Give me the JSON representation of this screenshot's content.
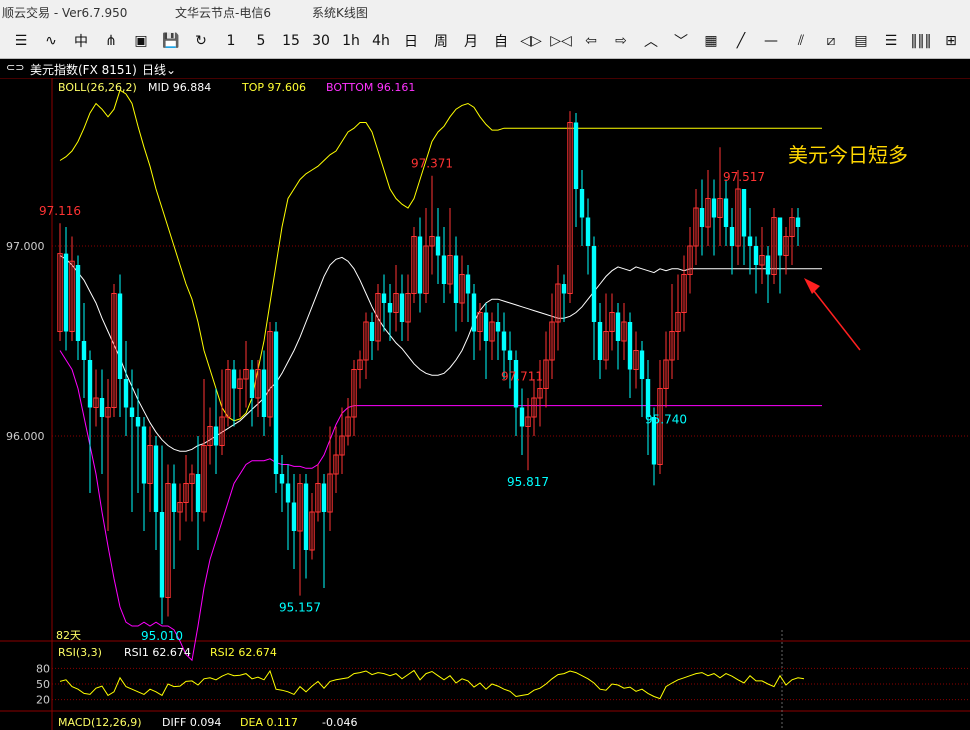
{
  "window": {
    "app_title": "顺云交易  -  Ver6.7.950",
    "node": "文华云节点-电信6",
    "menu": "系统K线图"
  },
  "toolbar": {
    "items": [
      "☰",
      "∿",
      "中",
      "⋔",
      "▣",
      "💾",
      "↻",
      "1",
      "5",
      "15",
      "30",
      "1h",
      "4h",
      "日",
      "周",
      "月",
      "自",
      "◁▷",
      "▷◁",
      "⇦",
      "⇨",
      "︿",
      "﹀",
      "▦",
      "╱",
      "—",
      "⫽",
      "⧄",
      "▤",
      "☰",
      "‖‖‖",
      "⊞"
    ]
  },
  "header": {
    "symbol": "美元指数(FX 8151)",
    "period": "日线"
  },
  "boll": {
    "label": "BOLL(26,26,2)",
    "mid_label": "MID",
    "mid": "96.884",
    "top_label": "TOP",
    "top": "97.606",
    "bottom_label": "BOTTOM",
    "bottom": "96.161"
  },
  "annotation_text": "美元今日短多",
  "bars_count_label": "82天",
  "rsi": {
    "label": "RSI(3,3)",
    "rsi1": "RSI1 62.674",
    "rsi2": "RSI2 62.674"
  },
  "macd": {
    "label": "MACD(12,26,9)",
    "diff": "DIFF 0.094",
    "dea": "DEA 0.117",
    "macd": "-0.046"
  },
  "colors": {
    "up": "#ff3333",
    "down": "#00ffff",
    "mid": "#ffffff",
    "upper": "#ffff00",
    "lower": "#ff00ff",
    "rsi": "#ffff00",
    "arrow": "#ff2020",
    "annotation": "#ffd700"
  },
  "chart_data": {
    "type": "candlestick",
    "y_ticks": [
      "97.000",
      "96.000"
    ],
    "ylim": [
      94.95,
      97.9
    ],
    "peak_labels": [
      {
        "value": "97.116",
        "bar": 0,
        "kind": "high"
      },
      {
        "value": "95.010",
        "bar": 17,
        "kind": "low"
      },
      {
        "value": "95.157",
        "bar": 40,
        "kind": "low"
      },
      {
        "value": "97.371",
        "bar": 62,
        "kind": "high"
      },
      {
        "value": "95.817",
        "bar": 78,
        "kind": "low"
      },
      {
        "value": "97.711",
        "bar": 77,
        "kind": "high"
      },
      {
        "value": "95.740",
        "bar": 101,
        "kind": "low"
      },
      {
        "value": "97.517",
        "bar": 114,
        "kind": "high"
      }
    ],
    "ohlc": [
      [
        96.55,
        96.96,
        96.5,
        97.12
      ],
      [
        96.96,
        96.55,
        96.45,
        97.1
      ],
      [
        96.55,
        96.92,
        96.5,
        97.05
      ],
      [
        96.9,
        96.5,
        96.4,
        96.95
      ],
      [
        96.5,
        96.4,
        96.2,
        96.7
      ],
      [
        96.4,
        96.15,
        95.7,
        96.45
      ],
      [
        96.15,
        96.2,
        96.05,
        96.35
      ],
      [
        96.2,
        96.1,
        95.8,
        96.35
      ],
      [
        96.1,
        96.15,
        95.5,
        96.3
      ],
      [
        96.15,
        96.75,
        96.1,
        96.8
      ],
      [
        96.75,
        96.3,
        96.1,
        96.85
      ],
      [
        96.3,
        96.15,
        96.0,
        96.5
      ],
      [
        96.15,
        96.1,
        95.6,
        96.35
      ],
      [
        96.1,
        96.05,
        95.7,
        96.25
      ],
      [
        96.05,
        95.75,
        95.5,
        96.1
      ],
      [
        95.75,
        95.95,
        95.6,
        96.05
      ],
      [
        95.95,
        95.6,
        95.4,
        96.0
      ],
      [
        95.6,
        95.15,
        95.01,
        95.95
      ],
      [
        95.15,
        95.75,
        95.05,
        95.85
      ],
      [
        95.75,
        95.6,
        95.3,
        95.85
      ],
      [
        95.6,
        95.65,
        95.45,
        95.75
      ],
      [
        95.65,
        95.75,
        95.55,
        95.9
      ],
      [
        95.75,
        95.8,
        95.55,
        95.85
      ],
      [
        95.8,
        95.6,
        95.4,
        96.0
      ],
      [
        95.6,
        95.95,
        95.55,
        96.3
      ],
      [
        95.95,
        96.05,
        95.85,
        96.15
      ],
      [
        96.05,
        95.95,
        95.8,
        96.25
      ],
      [
        95.95,
        96.1,
        95.9,
        96.35
      ],
      [
        96.1,
        96.35,
        96.05,
        96.4
      ],
      [
        96.35,
        96.25,
        96.05,
        96.4
      ],
      [
        96.25,
        96.3,
        96.1,
        96.35
      ],
      [
        96.3,
        96.35,
        96.15,
        96.5
      ],
      [
        96.35,
        96.2,
        96.05,
        96.4
      ],
      [
        96.2,
        96.35,
        96.1,
        96.4
      ],
      [
        96.35,
        96.1,
        96.0,
        96.45
      ],
      [
        96.1,
        96.55,
        96.05,
        96.6
      ],
      [
        96.55,
        95.8,
        95.7,
        96.6
      ],
      [
        95.8,
        95.75,
        95.6,
        95.9
      ],
      [
        95.75,
        95.65,
        95.4,
        95.85
      ],
      [
        95.65,
        95.5,
        95.3,
        95.8
      ],
      [
        95.5,
        95.75,
        95.16,
        95.8
      ],
      [
        95.75,
        95.4,
        95.25,
        95.8
      ],
      [
        95.4,
        95.6,
        95.35,
        95.7
      ],
      [
        95.6,
        95.75,
        95.55,
        95.85
      ],
      [
        95.75,
        95.6,
        95.2,
        95.8
      ],
      [
        95.6,
        95.8,
        95.5,
        96.05
      ],
      [
        95.8,
        95.9,
        95.7,
        96.05
      ],
      [
        95.9,
        96.0,
        95.8,
        96.15
      ],
      [
        96.0,
        96.1,
        95.95,
        96.2
      ],
      [
        96.1,
        96.35,
        96.0,
        96.4
      ],
      [
        96.35,
        96.4,
        96.25,
        96.45
      ],
      [
        96.4,
        96.6,
        96.3,
        96.65
      ],
      [
        96.6,
        96.5,
        96.4,
        96.65
      ],
      [
        96.5,
        96.75,
        96.45,
        96.8
      ],
      [
        96.75,
        96.7,
        96.55,
        96.85
      ],
      [
        96.7,
        96.65,
        96.5,
        96.8
      ],
      [
        96.65,
        96.75,
        96.55,
        96.9
      ],
      [
        96.75,
        96.6,
        96.5,
        96.85
      ],
      [
        96.6,
        96.75,
        96.5,
        96.85
      ],
      [
        96.75,
        97.05,
        96.7,
        97.1
      ],
      [
        97.05,
        96.75,
        96.65,
        97.15
      ],
      [
        96.75,
        97.0,
        96.7,
        97.2
      ],
      [
        97.0,
        97.05,
        96.85,
        97.37
      ],
      [
        97.05,
        96.95,
        96.8,
        97.2
      ],
      [
        96.95,
        96.8,
        96.7,
        97.1
      ],
      [
        96.8,
        96.95,
        96.75,
        97.2
      ],
      [
        96.95,
        96.7,
        96.55,
        97.05
      ],
      [
        96.7,
        96.85,
        96.6,
        96.95
      ],
      [
        96.85,
        96.75,
        96.6,
        96.9
      ],
      [
        96.75,
        96.55,
        96.4,
        96.8
      ],
      [
        96.55,
        96.65,
        96.45,
        96.7
      ],
      [
        96.65,
        96.5,
        96.3,
        96.7
      ],
      [
        96.5,
        96.6,
        96.4,
        96.65
      ],
      [
        96.6,
        96.55,
        96.4,
        96.7
      ],
      [
        96.55,
        96.45,
        96.3,
        96.65
      ],
      [
        96.45,
        96.4,
        96.25,
        96.55
      ],
      [
        96.4,
        96.15,
        96.0,
        96.45
      ],
      [
        96.15,
        96.05,
        95.9,
        96.25
      ],
      [
        96.05,
        96.1,
        95.82,
        96.2
      ],
      [
        96.1,
        96.2,
        96.0,
        96.3
      ],
      [
        96.2,
        96.25,
        96.05,
        96.4
      ],
      [
        96.25,
        96.4,
        96.15,
        96.55
      ],
      [
        96.4,
        96.6,
        96.3,
        96.75
      ],
      [
        96.6,
        96.8,
        96.45,
        96.9
      ],
      [
        96.8,
        96.75,
        96.6,
        96.85
      ],
      [
        96.75,
        97.65,
        96.7,
        97.71
      ],
      [
        97.65,
        97.3,
        97.1,
        97.7
      ],
      [
        97.3,
        97.15,
        97.0,
        97.4
      ],
      [
        97.15,
        97.0,
        96.85,
        97.25
      ],
      [
        97.0,
        96.6,
        96.4,
        97.05
      ],
      [
        96.6,
        96.4,
        96.3,
        96.7
      ],
      [
        96.4,
        96.55,
        96.35,
        96.75
      ],
      [
        96.55,
        96.65,
        96.45,
        96.75
      ],
      [
        96.65,
        96.5,
        96.35,
        96.7
      ],
      [
        96.5,
        96.6,
        96.4,
        96.7
      ],
      [
        96.6,
        96.35,
        96.2,
        96.65
      ],
      [
        96.35,
        96.45,
        96.25,
        96.55
      ],
      [
        96.45,
        96.3,
        96.1,
        96.5
      ],
      [
        96.3,
        96.1,
        95.9,
        96.4
      ],
      [
        96.1,
        95.85,
        95.74,
        96.15
      ],
      [
        95.85,
        96.25,
        95.8,
        96.4
      ],
      [
        96.25,
        96.4,
        96.15,
        96.55
      ],
      [
        96.4,
        96.55,
        96.3,
        96.8
      ],
      [
        96.55,
        96.65,
        96.4,
        96.85
      ],
      [
        96.65,
        96.85,
        96.55,
        96.95
      ],
      [
        96.85,
        97.0,
        96.75,
        97.1
      ],
      [
        97.0,
        97.2,
        96.9,
        97.3
      ],
      [
        97.2,
        97.1,
        96.95,
        97.35
      ],
      [
        97.1,
        97.25,
        97.0,
        97.4
      ],
      [
        97.25,
        97.15,
        96.95,
        97.35
      ],
      [
        97.15,
        97.25,
        97.0,
        97.52
      ],
      [
        97.25,
        97.1,
        97.0,
        97.35
      ],
      [
        97.1,
        97.0,
        96.85,
        97.2
      ],
      [
        97.0,
        97.3,
        96.9,
        97.4
      ],
      [
        97.3,
        97.05,
        96.9,
        97.3
      ],
      [
        97.05,
        97.0,
        96.85,
        97.2
      ],
      [
        97.0,
        96.9,
        96.75,
        97.05
      ],
      [
        96.9,
        96.95,
        96.8,
        97.1
      ],
      [
        96.95,
        96.85,
        96.7,
        97.0
      ],
      [
        96.85,
        97.15,
        96.8,
        97.2
      ],
      [
        97.15,
        96.95,
        96.75,
        97.15
      ],
      [
        96.95,
        97.05,
        96.85,
        97.1
      ],
      [
        97.05,
        97.15,
        96.9,
        97.2
      ],
      [
        97.15,
        97.1,
        97.0,
        97.2
      ]
    ],
    "boll_mid": [
      96.95,
      96.93,
      96.9,
      96.86,
      96.82,
      96.76,
      96.7,
      96.62,
      96.55,
      96.48,
      96.41,
      96.33,
      96.26,
      96.19,
      96.13,
      96.07,
      96.02,
      95.98,
      95.95,
      95.93,
      95.92,
      95.92,
      95.93,
      95.95,
      95.96,
      95.98,
      96.0,
      96.02,
      96.04,
      96.06,
      96.08,
      96.11,
      96.14,
      96.17,
      96.2,
      96.25,
      96.28,
      96.33,
      96.39,
      96.45,
      96.52,
      96.6,
      96.68,
      96.76,
      96.84,
      96.9,
      96.93,
      96.94,
      96.92,
      96.88,
      96.82,
      96.75,
      96.68,
      96.62,
      96.57,
      96.53,
      96.49,
      96.46,
      96.42,
      96.38,
      96.35,
      96.33,
      96.32,
      96.32,
      96.33,
      96.36,
      96.4,
      96.45,
      96.52,
      96.6,
      96.66,
      96.7,
      96.72,
      96.72,
      96.71,
      96.7,
      96.69,
      96.68,
      96.67,
      96.66,
      96.65,
      96.64,
      96.63,
      96.62,
      96.62,
      96.63,
      96.65,
      96.68,
      96.72,
      96.76,
      96.8,
      96.84,
      96.87,
      96.89,
      96.88,
      96.87,
      96.89,
      96.88,
      96.87,
      96.86,
      96.88,
      96.87,
      96.88,
      96.88,
      96.87,
      96.88,
      96.88,
      96.88,
      96.88,
      96.88,
      96.88,
      96.88,
      96.88,
      96.88,
      96.88,
      96.88,
      96.88,
      96.88,
      96.88,
      96.88,
      96.88,
      96.88,
      96.88,
      96.88,
      96.88,
      96.88,
      96.88,
      96.88
    ],
    "boll_upper": [
      97.45,
      97.47,
      97.5,
      97.55,
      97.62,
      97.7,
      97.75,
      97.72,
      97.68,
      97.72,
      97.82,
      97.8,
      97.75,
      97.63,
      97.52,
      97.42,
      97.3,
      97.2,
      97.1,
      97.0,
      96.9,
      96.8,
      96.72,
      96.6,
      96.45,
      96.35,
      96.25,
      96.15,
      96.1,
      96.08,
      96.09,
      96.12,
      96.2,
      96.35,
      96.5,
      96.7,
      96.9,
      97.1,
      97.25,
      97.3,
      97.35,
      97.38,
      97.4,
      97.42,
      97.45,
      97.48,
      97.5,
      97.55,
      97.6,
      97.62,
      97.65,
      97.65,
      97.6,
      97.5,
      97.4,
      97.3,
      97.25,
      97.22,
      97.2,
      97.25,
      97.35,
      97.45,
      97.55,
      97.6,
      97.63,
      97.68,
      97.72,
      97.74,
      97.75,
      97.73,
      97.68,
      97.64,
      97.61,
      97.61,
      97.62,
      97.62,
      97.62,
      97.62,
      97.62,
      97.62,
      97.62,
      97.62,
      97.62,
      97.62,
      97.62,
      97.62,
      97.62,
      97.62,
      97.62,
      97.62,
      97.62,
      97.62,
      97.62,
      97.62,
      97.62,
      97.62,
      97.62,
      97.62,
      97.62,
      97.62,
      97.62,
      97.62,
      97.62,
      97.62,
      97.62,
      97.62,
      97.62,
      97.62,
      97.62,
      97.62,
      97.62,
      97.62,
      97.62,
      97.62,
      97.62,
      97.62,
      97.62,
      97.62,
      97.62,
      97.62,
      97.62,
      97.62,
      97.62,
      97.62,
      97.62,
      97.62,
      97.62,
      97.62
    ],
    "boll_lower": [
      96.45,
      96.4,
      96.35,
      96.25,
      96.1,
      95.95,
      95.8,
      95.6,
      95.42,
      95.25,
      95.1,
      95.02,
      95.0,
      95.0,
      95.02,
      95.0,
      95.02,
      95.0,
      95.0,
      94.98,
      94.92,
      94.85,
      94.82,
      95.0,
      95.2,
      95.35,
      95.45,
      95.55,
      95.65,
      95.75,
      95.8,
      95.85,
      95.87,
      95.87,
      95.87,
      95.88,
      95.86,
      95.85,
      95.85,
      95.84,
      95.84,
      95.83,
      95.83,
      95.85,
      95.9,
      95.98,
      96.06,
      96.12,
      96.15,
      96.16,
      96.16,
      96.16,
      96.16,
      96.16,
      96.16,
      96.16,
      96.16,
      96.16,
      96.16,
      96.16,
      96.16,
      96.16,
      96.16,
      96.16,
      96.16,
      96.16,
      96.16,
      96.16,
      96.16,
      96.16,
      96.16,
      96.16,
      96.16,
      96.16,
      96.16,
      96.16,
      96.16,
      96.16,
      96.16,
      96.16,
      96.16,
      96.16,
      96.16,
      96.16,
      96.16,
      96.16,
      96.16,
      96.16,
      96.16,
      96.16,
      96.16,
      96.16,
      96.16,
      96.16,
      96.16,
      96.16,
      96.16,
      96.16,
      96.16,
      96.16,
      96.16,
      96.16,
      96.16,
      96.16,
      96.16,
      96.16,
      96.16,
      96.16,
      96.16,
      96.16,
      96.16,
      96.16,
      96.16,
      96.16,
      96.16,
      96.16,
      96.16,
      96.16,
      96.16,
      96.16,
      96.16,
      96.16,
      96.16,
      96.16,
      96.16,
      96.16,
      96.16,
      96.16
    ],
    "rsi_ticks": [
      "80",
      "50",
      "20"
    ],
    "rsi_values": [
      55,
      58,
      45,
      40,
      32,
      30,
      42,
      46,
      28,
      35,
      62,
      45,
      40,
      35,
      30,
      40,
      35,
      28,
      50,
      45,
      46,
      55,
      56,
      48,
      60,
      62,
      58,
      65,
      70,
      66,
      67,
      70,
      60,
      63,
      58,
      75,
      40,
      38,
      35,
      30,
      45,
      35,
      46,
      55,
      42,
      55,
      58,
      60,
      62,
      70,
      72,
      75,
      68,
      72,
      70,
      66,
      70,
      60,
      68,
      76,
      58,
      70,
      74,
      66,
      58,
      66,
      52,
      60,
      56,
      44,
      52,
      40,
      50,
      46,
      40,
      36,
      26,
      28,
      30,
      38,
      42,
      50,
      60,
      68,
      70,
      75,
      72,
      66,
      60,
      52,
      40,
      38,
      50,
      48,
      42,
      44,
      36,
      40,
      32,
      26,
      22,
      45,
      52,
      58,
      62,
      66,
      70,
      72,
      66,
      70,
      62,
      70,
      65,
      58,
      52,
      66,
      56,
      56,
      50,
      45,
      66,
      48,
      58,
      62,
      60
    ]
  }
}
